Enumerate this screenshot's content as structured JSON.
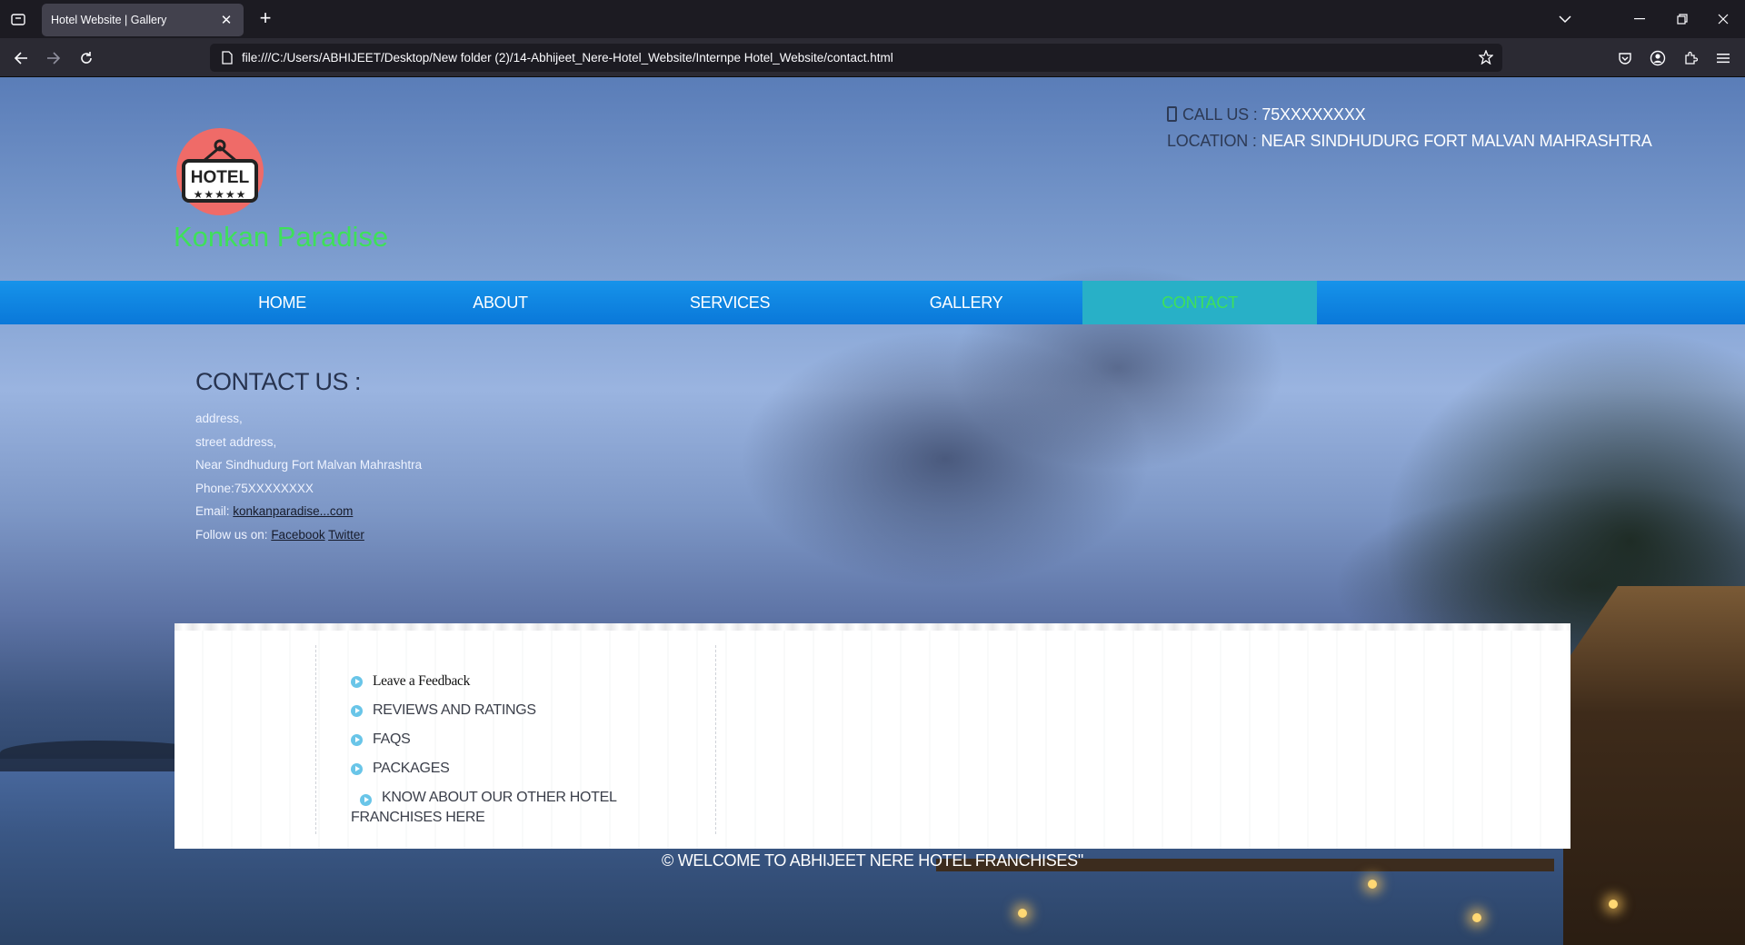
{
  "browser": {
    "tab_title": "Hotel Website | Gallery",
    "url": "file:///C:/Users/ABHIJEET/Desktop/New folder (2)/14-Abhijeet_Nere-Hotel_Website/Internpe Hotel_Website/contact.html"
  },
  "header": {
    "logo_text": "HOTEL",
    "logo_stars": "★★★★★",
    "brand": "Konkan Paradise",
    "call_label": "CALL US :",
    "call_value": "75XXXXXXXX",
    "location_label": "LOCATION :",
    "location_value": "NEAR SINDHUDURG FORT MALVAN MAHRASHTRA"
  },
  "menu": {
    "items": [
      {
        "label": "HOME"
      },
      {
        "label": "ABOUT"
      },
      {
        "label": "SERVICES"
      },
      {
        "label": "GALLERY"
      },
      {
        "label": "CONTACT"
      }
    ],
    "active": "CONTACT"
  },
  "contact": {
    "heading": "CONTACT US :",
    "line1": "address,",
    "line2": "street address,",
    "line3": "Near Sindhudurg Fort Malvan Mahrashtra",
    "phone": "Phone:75XXXXXXXX",
    "email_label": "Email:",
    "email": "konkanparadise...com",
    "follow_label": "Follow us on:",
    "facebook": "Facebook",
    "twitter": "Twitter"
  },
  "footer": {
    "links": [
      {
        "label": "Leave a Feedback"
      },
      {
        "label": "REVIEWS AND RATINGS"
      },
      {
        "label": "FAQS"
      },
      {
        "label": "PACKAGES"
      },
      {
        "label": "KNOW ABOUT OUR OTHER HOTEL FRANCHISES HERE"
      }
    ],
    "copyright": "© WELCOME TO ABHIJEET NERE HOTEL FRANCHISES\""
  },
  "colors": {
    "brand_green": "#3ee05a",
    "menu_blue": "#0a78d9",
    "menu_active": "#28b0c7"
  }
}
